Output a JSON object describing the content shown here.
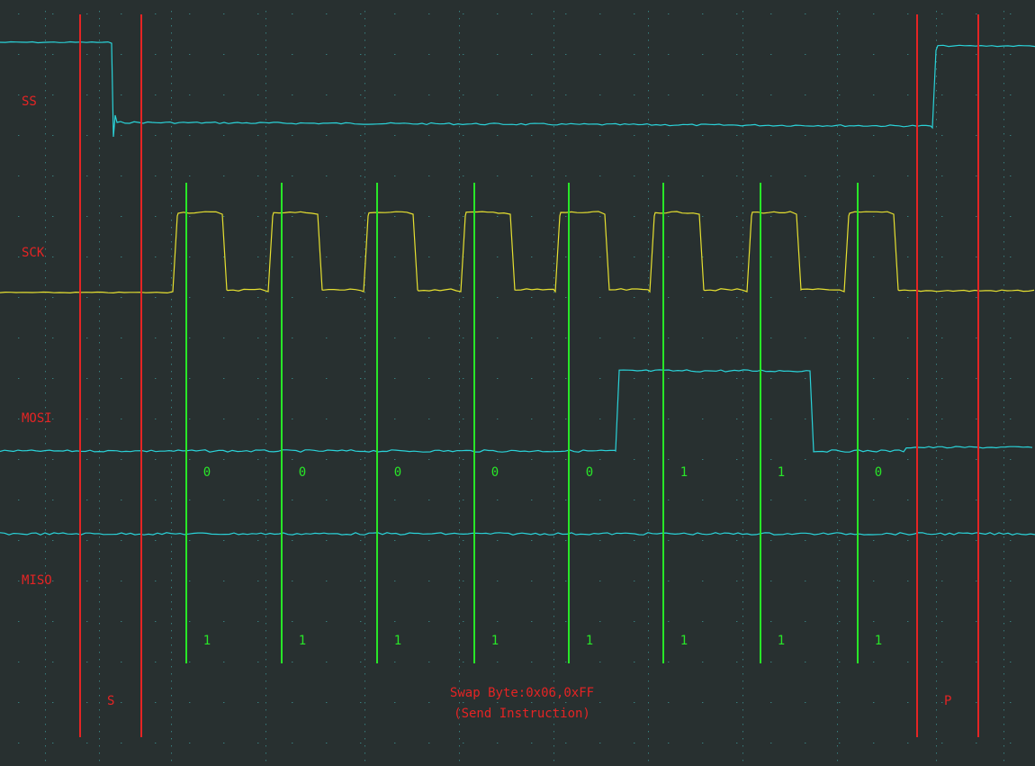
{
  "chart_data": {
    "type": "line",
    "title": "",
    "xlabel": "",
    "ylabel": "",
    "grid": true,
    "channels": [
      {
        "name": "SS",
        "label": "SS",
        "color": "#2ad2d8"
      },
      {
        "name": "SCK",
        "label": "SCK",
        "color": "#e6e030"
      },
      {
        "name": "MOSI",
        "label": "MOSI",
        "color": "#2ad2d8"
      },
      {
        "name": "MISO",
        "label": "MISO",
        "color": "#2ad2d8"
      }
    ],
    "x_units": "bit-cell",
    "ss_levels": [
      1,
      0,
      1
    ],
    "sck_pulses": 8,
    "mosi_bits": [
      "0",
      "0",
      "0",
      "0",
      "0",
      "1",
      "1",
      "0"
    ],
    "miso_bits": [
      "1",
      "1",
      "1",
      "1",
      "1",
      "1",
      "1",
      "1"
    ],
    "markers": {
      "start_label": "S",
      "stop_label": "P",
      "marker_color": "#e52424",
      "sample_color": "#28e628"
    },
    "caption": {
      "line1": "Swap Byte:0x06,0xFF",
      "line2": "(Send Instruction)"
    }
  }
}
